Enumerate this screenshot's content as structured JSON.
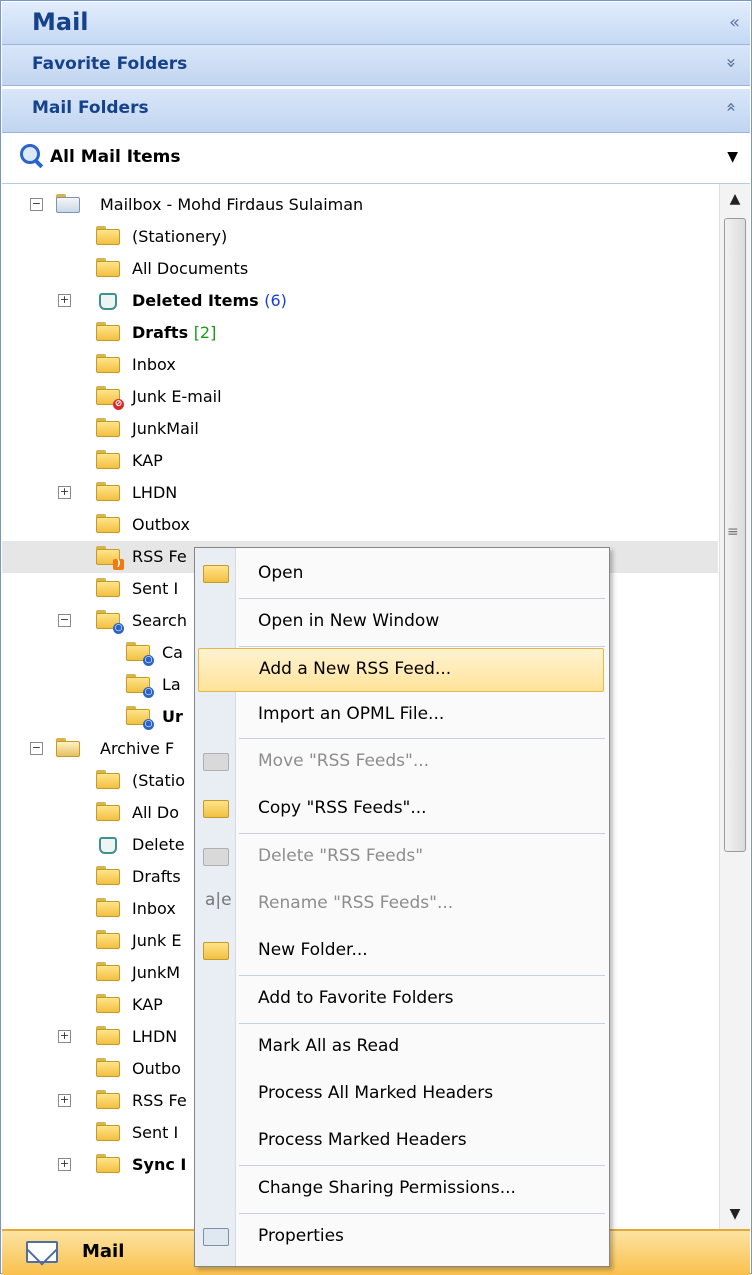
{
  "header": {
    "title": "Mail",
    "collapse_glyph": "«"
  },
  "sections": {
    "favorite": {
      "label": "Favorite Folders",
      "chevron": "»"
    },
    "mail": {
      "label": "Mail Folders",
      "chevron": "«"
    }
  },
  "view_selector": {
    "label": "All Mail Items",
    "dropdown_glyph": "▼"
  },
  "tree": {
    "mailbox": {
      "label": "Mailbox - Mohd Firdaus Sulaiman"
    },
    "items": [
      {
        "label": "(Stationery)"
      },
      {
        "label": "All Documents"
      },
      {
        "label": "Deleted Items",
        "count": "(6)"
      },
      {
        "label": "Drafts",
        "count": "[2]"
      },
      {
        "label": "Inbox"
      },
      {
        "label": "Junk E-mail"
      },
      {
        "label": "JunkMail"
      },
      {
        "label": "KAP"
      },
      {
        "label": "LHDN"
      },
      {
        "label": "Outbox"
      },
      {
        "label": "RSS Fe"
      },
      {
        "label": "Sent I"
      },
      {
        "label": "Search"
      },
      {
        "label": "Ca"
      },
      {
        "label": "La"
      },
      {
        "label": "Ur"
      }
    ],
    "archive": {
      "label": "Archive F"
    },
    "archive_items": [
      {
        "label": "(Statio"
      },
      {
        "label": "All Do"
      },
      {
        "label": "Delete"
      },
      {
        "label": "Drafts"
      },
      {
        "label": "Inbox"
      },
      {
        "label": "Junk E"
      },
      {
        "label": "JunkM"
      },
      {
        "label": "KAP"
      },
      {
        "label": "LHDN"
      },
      {
        "label": "Outbo"
      },
      {
        "label": "RSS Fe"
      },
      {
        "label": "Sent I"
      },
      {
        "label": "Sync I"
      }
    ]
  },
  "scrollbar": {
    "up": "▲",
    "down": "▼",
    "grip": "≡"
  },
  "navbar": {
    "label": "Mail"
  },
  "context_menu": {
    "items": [
      {
        "label": "Open"
      },
      {
        "label": "Open in New Window"
      },
      {
        "label": "Add a New RSS Feed..."
      },
      {
        "label": "Import an OPML File..."
      },
      {
        "label": "Move \"RSS Feeds\"..."
      },
      {
        "label": "Copy \"RSS Feeds\"..."
      },
      {
        "label": "Delete \"RSS Feeds\""
      },
      {
        "label": "Rename \"RSS Feeds\"..."
      },
      {
        "label": "New Folder..."
      },
      {
        "label": "Add to Favorite Folders"
      },
      {
        "label": "Mark All as Read"
      },
      {
        "label": "Process All Marked Headers"
      },
      {
        "label": "Process Marked Headers"
      },
      {
        "label": "Change Sharing Permissions..."
      },
      {
        "label": "Properties"
      }
    ]
  },
  "colors": {
    "accent": "#15428b",
    "nav_active": "#f9c04c",
    "menu_hover": "#ffe39a"
  }
}
